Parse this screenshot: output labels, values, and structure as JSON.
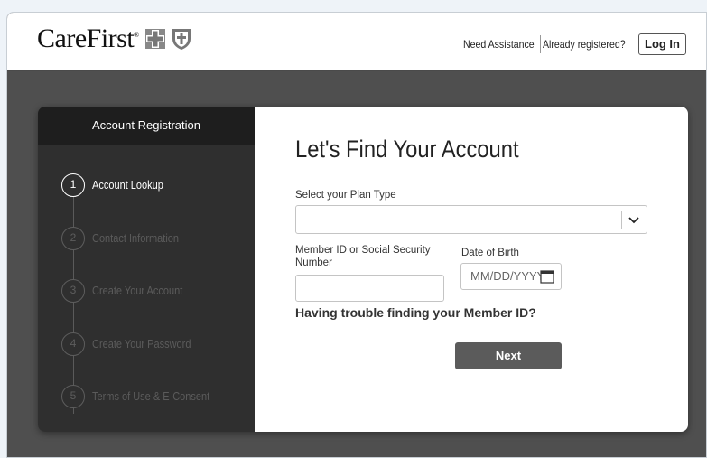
{
  "header": {
    "logo_text": "CareFirst",
    "logo_mark": "®",
    "need_assistance": "Need Assistance",
    "already_registered": "Already registered?",
    "login_label": "Log In"
  },
  "sidebar": {
    "title": "Account Registration",
    "steps": [
      {
        "num": "1",
        "label": "Account Lookup",
        "active": true
      },
      {
        "num": "2",
        "label": "Contact Information",
        "active": false
      },
      {
        "num": "3",
        "label": "Create Your Account",
        "active": false
      },
      {
        "num": "4",
        "label": "Create Your Password",
        "active": false
      },
      {
        "num": "5",
        "label": "Terms of Use & E-Consent",
        "active": false
      }
    ]
  },
  "form": {
    "title": "Let's Find Your Account",
    "plan_type_label": "Select your Plan Type",
    "plan_type_value": "",
    "member_id_label_line1": "Member ID or Social Security",
    "member_id_label_line2": "Number",
    "member_id_value": "",
    "dob_label": "Date of Birth",
    "dob_placeholder": "MM/DD/YYYY",
    "trouble_link": "Having trouble finding your Member ID?",
    "next_label": "Next"
  },
  "colors": {
    "page_bg": "#eef3f8",
    "overlay_bg": "#4f4f4f",
    "sidebar_bg": "#2f2f2f",
    "sidebar_head_bg": "#1e1e1e",
    "button_bg": "#5b5b5b"
  },
  "icons": [
    "cross-logo-icon",
    "shield-logo-icon",
    "chevron-down-icon",
    "calendar-icon"
  ]
}
